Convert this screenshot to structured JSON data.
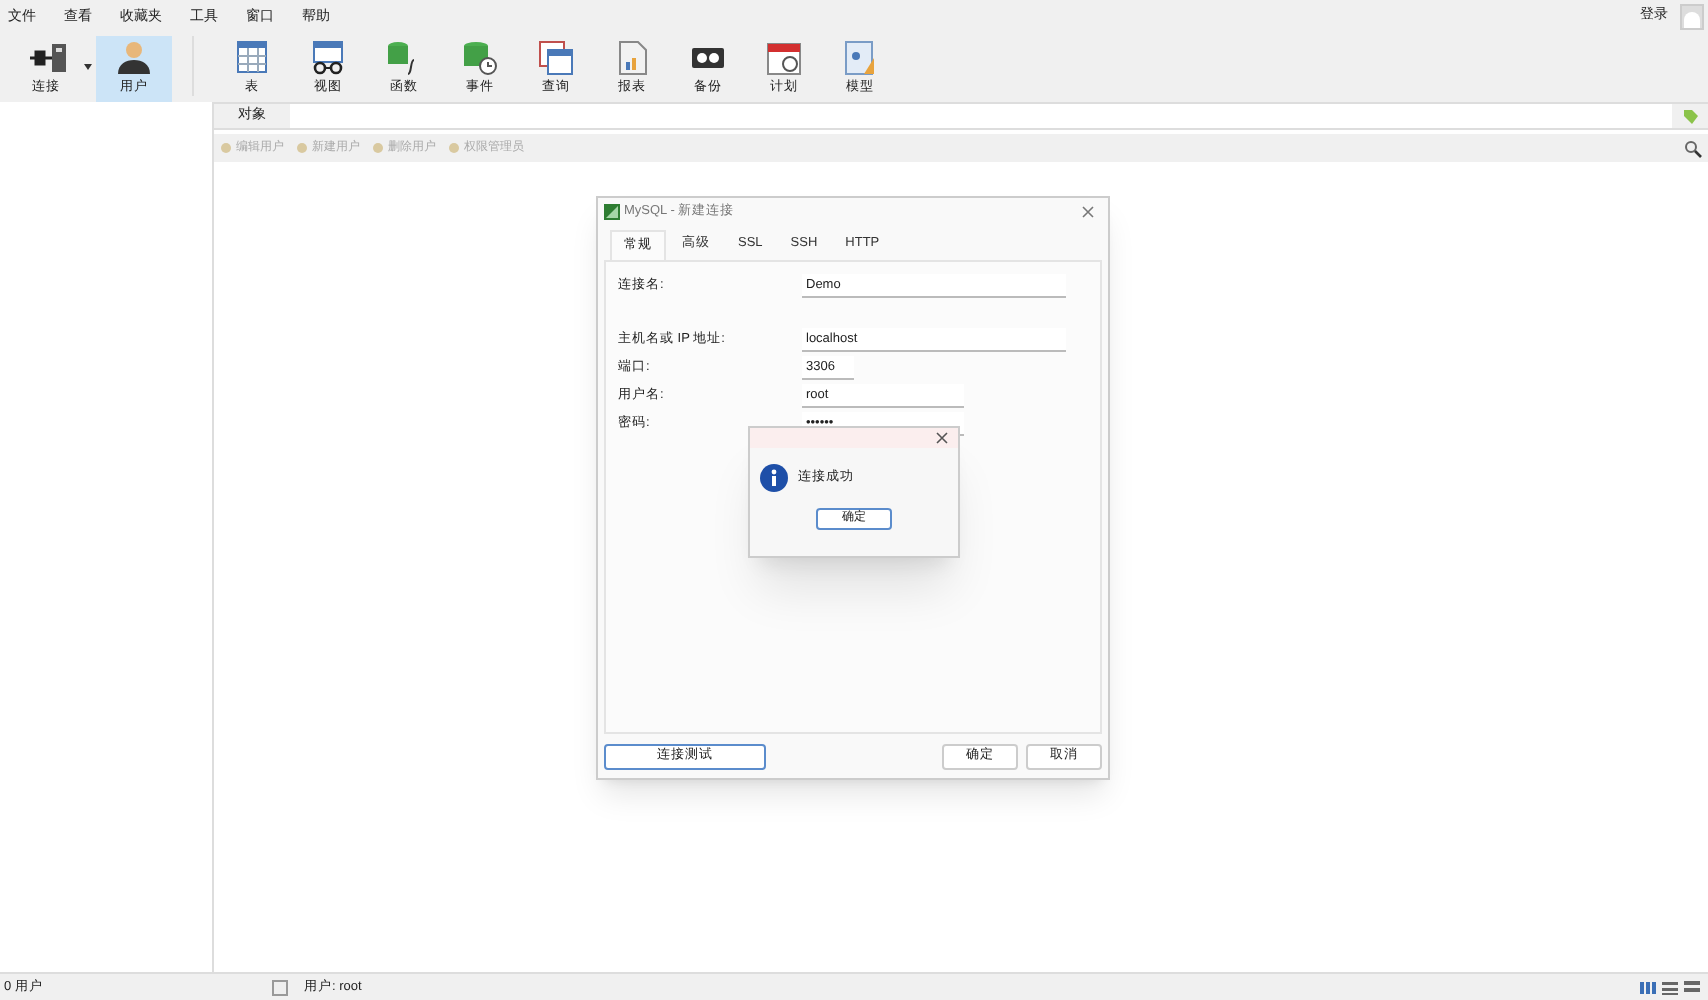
{
  "menu": [
    {
      "label": "文件"
    },
    {
      "label": "查看"
    },
    {
      "label": "收藏夹"
    },
    {
      "label": "工具"
    },
    {
      "label": "窗口"
    },
    {
      "label": "帮助"
    }
  ],
  "login": "登录",
  "toolbar": [
    {
      "label": "连接",
      "kind": "connection",
      "selected": false
    },
    {
      "label": "用户",
      "kind": "user",
      "selected": true
    },
    {
      "label": "表",
      "kind": "table",
      "selected": false
    },
    {
      "label": "视图",
      "kind": "view",
      "selected": false
    },
    {
      "label": "函数",
      "kind": "function",
      "selected": false
    },
    {
      "label": "事件",
      "kind": "event",
      "selected": false
    },
    {
      "label": "查询",
      "kind": "query",
      "selected": false
    },
    {
      "label": "报表",
      "kind": "report",
      "selected": false
    },
    {
      "label": "备份",
      "kind": "backup",
      "selected": false
    },
    {
      "label": "计划",
      "kind": "schedule",
      "selected": false
    },
    {
      "label": "模型",
      "kind": "model",
      "selected": false
    }
  ],
  "object_tab": "对象",
  "actions": [
    {
      "label": "编辑用户",
      "disabled": true
    },
    {
      "label": "新建用户",
      "disabled": true
    },
    {
      "label": "删除用户",
      "disabled": true
    },
    {
      "label": "权限管理员",
      "disabled": true
    }
  ],
  "dialog": {
    "title": "MySQL - 新建连接",
    "tabs": [
      {
        "label": "常规",
        "selected": true
      },
      {
        "label": "高级",
        "selected": false
      },
      {
        "label": "SSL",
        "selected": false
      },
      {
        "label": "SSH",
        "selected": false
      },
      {
        "label": "HTTP",
        "selected": false
      }
    ],
    "fields": [
      {
        "label": "连接名:",
        "value": "Demo"
      },
      {
        "label": "主机名或 IP 地址:",
        "value": "localhost"
      },
      {
        "label": "端口:",
        "value": "3306"
      },
      {
        "label": "用户名:",
        "value": "root"
      },
      {
        "label": "密码:",
        "value": "••••••"
      }
    ],
    "test_button": "连接测试",
    "ok_button": "确定",
    "cancel_button": "取消"
  },
  "alert": {
    "message": "连接成功",
    "button": "确定"
  },
  "status_bar": {
    "count": "0 用户",
    "user": "用户: root"
  }
}
